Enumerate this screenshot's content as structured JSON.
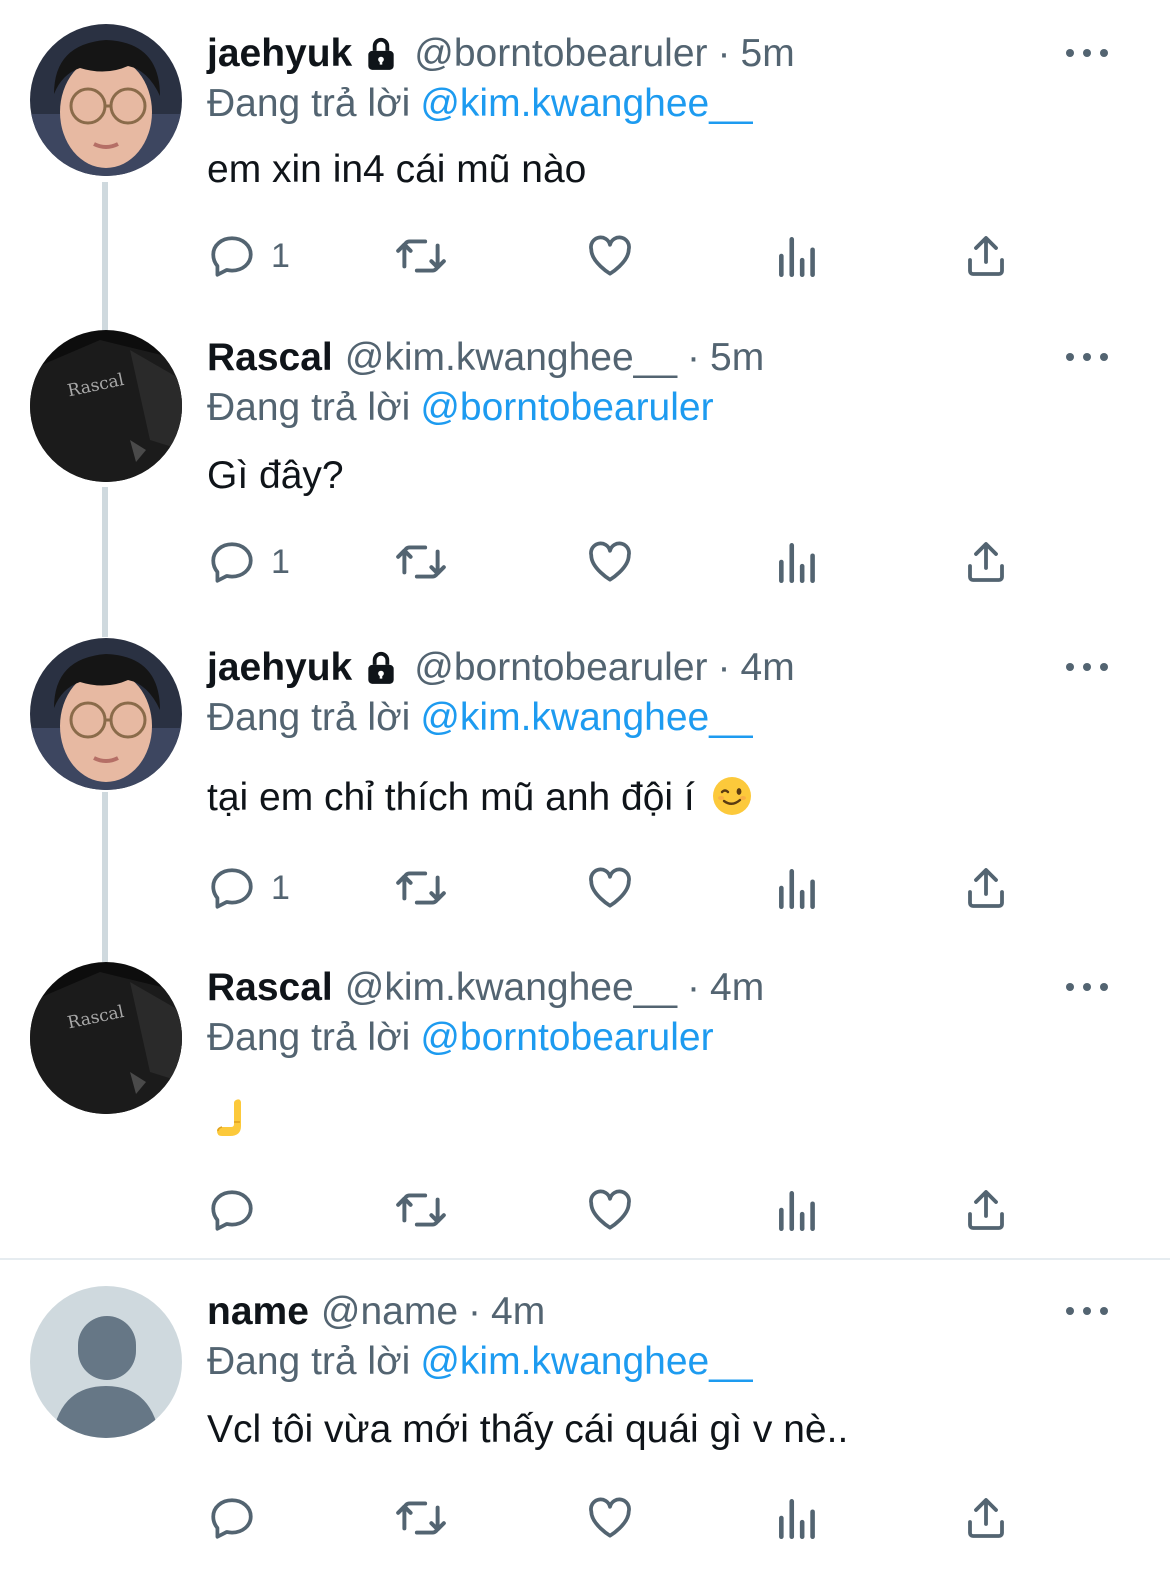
{
  "tweets": [
    {
      "display_name": "jaehyuk",
      "protected": true,
      "handle": "@borntobearuler",
      "time": "5m",
      "reply_prefix": "Đang trả lời",
      "reply_to": "@kim.kwanghee__",
      "text": "em xin in4 cái mũ nào",
      "reply_count": "1",
      "avatar": "photo-person-glasses"
    },
    {
      "display_name": "Rascal",
      "protected": false,
      "handle": "@kim.kwanghee__",
      "time": "5m",
      "reply_prefix": "Đang trả lời",
      "reply_to": "@borntobearuler",
      "text": "Gì đây?",
      "reply_count": "1",
      "avatar": "photo-black-jersey"
    },
    {
      "display_name": "jaehyuk",
      "protected": true,
      "handle": "@borntobearuler",
      "time": "4m",
      "reply_prefix": "Đang trả lời",
      "reply_to": "@kim.kwanghee__",
      "text": "tại em chỉ thích mũ anh đội í",
      "emoji": "winking-face",
      "reply_count": "1",
      "avatar": "photo-person-glasses"
    },
    {
      "display_name": "Rascal",
      "protected": false,
      "handle": "@kim.kwanghee__",
      "time": "4m",
      "reply_prefix": "Đang trả lời",
      "reply_to": "@borntobearuler",
      "text": "",
      "emoji": "pointing-hand",
      "reply_count": "",
      "avatar": "photo-black-jersey"
    },
    {
      "display_name": "name",
      "protected": false,
      "handle": "@name",
      "time": "4m",
      "reply_prefix": "Đang trả lời",
      "reply_to": "@kim.kwanghee__",
      "text": "Vcl tôi vừa mới thấy cái quái gì v nè..",
      "reply_count": "",
      "avatar": "default-avatar"
    }
  ],
  "separator": "·",
  "icons": [
    "reply-icon",
    "retweet-icon",
    "like-icon",
    "views-icon",
    "share-icon",
    "more-icon",
    "lock-icon"
  ],
  "colors": {
    "text": "#0f1419",
    "secondary": "#536471",
    "link": "#1d9bf0",
    "thread_line": "#cfd9de",
    "divider": "#e6ecf0"
  }
}
